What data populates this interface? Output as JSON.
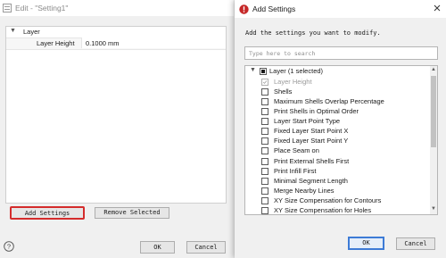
{
  "colors": {
    "highlight_border": "#d42c2c",
    "default_button_border": "#3d7bd6",
    "title_icon": "#c62828"
  },
  "edit_window": {
    "title": "Edit - \"Setting1\"",
    "title_icon": "app-icon",
    "group": {
      "label": "Layer",
      "icon": "chevron-down-icon"
    },
    "row": {
      "name": "Layer Height",
      "value": "0.1000 mm"
    },
    "add_settings_label": "Add Settings",
    "remove_selected_label": "Remove Selected",
    "help_icon": "help-icon",
    "ok_label": "OK",
    "cancel_label": "Cancel"
  },
  "add_dialog": {
    "title": "Add Settings",
    "title_icon": "alert-icon",
    "close_icon": "close-icon",
    "instruction": "Add the settings you want to modify.",
    "search_placeholder": "Type here to search",
    "group": {
      "label": "Layer (1 selected)",
      "icon": "chevron-down-icon"
    },
    "items": [
      {
        "label": "Layer Height",
        "checked": true,
        "disabled": true
      },
      {
        "label": "Shells",
        "checked": false
      },
      {
        "label": "Maximum Shells Overlap Percentage",
        "checked": false
      },
      {
        "label": "Print Shells in Optimal Order",
        "checked": false
      },
      {
        "label": "Layer Start Point Type",
        "checked": false
      },
      {
        "label": "Fixed Layer Start Point X",
        "checked": false
      },
      {
        "label": "Fixed Layer Start Point Y",
        "checked": false
      },
      {
        "label": "Place Seam on",
        "checked": false
      },
      {
        "label": "Print External Shells First",
        "checked": false
      },
      {
        "label": "Print Infill First",
        "checked": false
      },
      {
        "label": "Minimal Segment Length",
        "checked": false
      },
      {
        "label": "Merge Nearby Lines",
        "checked": false
      },
      {
        "label": "XY Size Compensation for Contours",
        "checked": false
      },
      {
        "label": "XY Size Compensation for Holes",
        "checked": false
      }
    ],
    "ok_label": "OK",
    "cancel_label": "Cancel"
  }
}
